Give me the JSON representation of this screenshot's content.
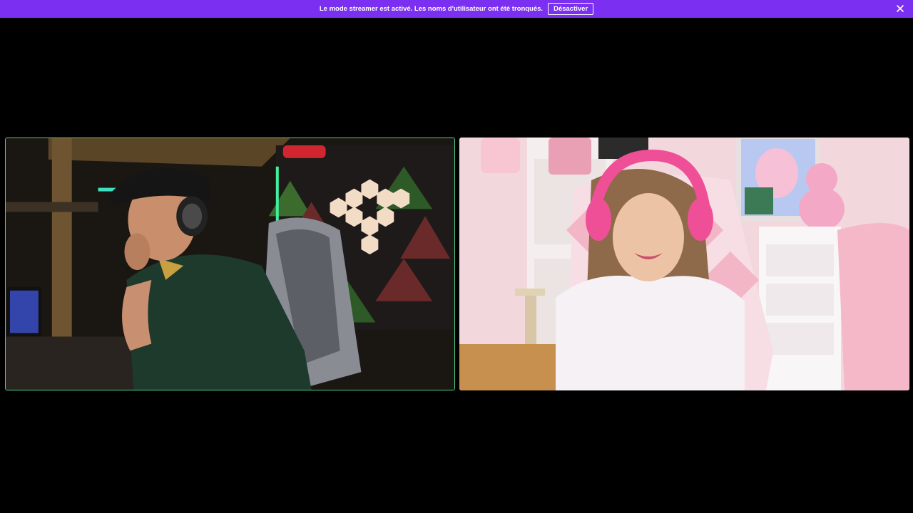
{
  "banner": {
    "message": "Le mode streamer est activé. Les noms d'utilisateur ont été tronqués.",
    "disable_label": "Désactiver",
    "close_icon": "close-icon"
  },
  "colors": {
    "banner_bg": "#7b2ff0",
    "active_speaker_border": "#4fd28a",
    "stage_bg": "#000000"
  },
  "tiles": [
    {
      "id": "left",
      "active_speaker": true
    },
    {
      "id": "right",
      "active_speaker": false
    }
  ]
}
